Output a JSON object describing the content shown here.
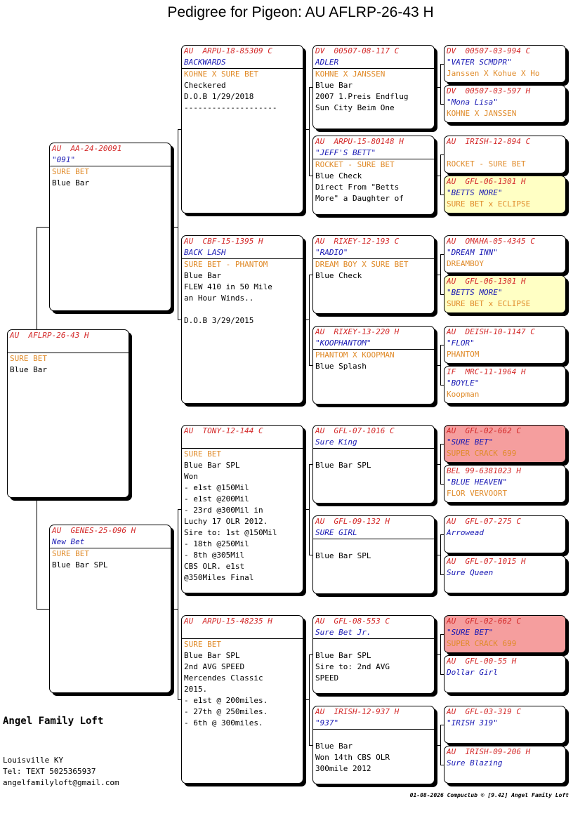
{
  "title": "Pedigree for Pigeon: AU  AFLRP-26-43 H",
  "cards": [
    {
      "id": "subject",
      "band": "AU  AFLRP-26-43 H",
      "name": "",
      "strain": "SURE BET",
      "notes": [
        "Blue Bar"
      ],
      "hl": ""
    },
    {
      "id": "sire",
      "band": "AU  AA-24-20091",
      "name": "\"091\"",
      "strain": "SURE BET",
      "notes": [
        "Blue Bar"
      ],
      "hl": ""
    },
    {
      "id": "dam",
      "band": "AU  GENES-25-096 H",
      "name": "New Bet",
      "strain": "SURE BET",
      "notes": [
        "Blue Bar SPL"
      ],
      "hl": ""
    },
    {
      "id": "ss",
      "band": "AU  ARPU-18-85309 C",
      "name": "BACKWARDS",
      "strain": "KOHNE X SURE BET",
      "notes": [
        "Checkered",
        "D.O.B 1/29/2018",
        "--------------------"
      ],
      "hl": ""
    },
    {
      "id": "sd",
      "band": "AU  CBF-15-1395 H",
      "name": "BACK LASH",
      "strain": "SURE BET - PHANTOM",
      "notes": [
        "Blue Bar",
        "FLEW 410 in 50 Mile",
        "an Hour Winds..",
        "",
        "D.O.B 3/29/2015"
      ],
      "hl": ""
    },
    {
      "id": "ds",
      "band": "AU  TONY-12-144 C",
      "name": "",
      "strain": "SURE BET",
      "notes": [
        "Blue Bar SPL",
        "Won",
        "- e1st @150Mil",
        "- e1st @200Mil",
        "- 23rd @300Mil in",
        "Luchy 17 OLR 2012.",
        "Sire to: 1st @150Mil",
        "- 18th @250Mil",
        "- 8th @305Mil",
        "CBS OLR. e1st",
        "@350Miles Final"
      ],
      "hl": ""
    },
    {
      "id": "dd",
      "band": "AU  ARPU-15-48235 H",
      "name": "",
      "strain": "SURE BET",
      "notes": [
        "Blue Bar SPL",
        "2nd AVG SPEED",
        "Mercendes Classic",
        "2015.",
        "- e1st @ 200miles.",
        "- 27th @ 250miles.",
        "- 6th @ 300miles."
      ],
      "hl": ""
    },
    {
      "id": "sss",
      "band": "DV  00507-08-117 C",
      "name": "ADLER",
      "strain": "KOHNE X JANSSEN",
      "notes": [
        "Blue Bar",
        "2007 1.Preis Endflug",
        "Sun City Beim One"
      ],
      "hl": ""
    },
    {
      "id": "ssd",
      "band": "AU  ARPU-15-80148 H",
      "name": "\"JEFF'S BETT\"",
      "strain": "ROCKET - SURE BET",
      "notes": [
        "Blue Check",
        "Direct From \"Betts",
        "More\" a Daughter of"
      ],
      "hl": ""
    },
    {
      "id": "sds",
      "band": "AU  RIXEY-12-193 C",
      "name": "\"RADIO\"",
      "strain": "DREAM BOY X SURE BET",
      "notes": [
        "Blue Check"
      ],
      "hl": ""
    },
    {
      "id": "sdd",
      "band": "AU  RIXEY-13-220 H",
      "name": "\"KOOPHANTOM\"",
      "strain": "PHANTOM X KOOPMAN",
      "notes": [
        "Blue Splash"
      ],
      "hl": ""
    },
    {
      "id": "dss",
      "band": "AU  GFL-07-1016 C",
      "name": "Sure King",
      "strain": "",
      "notes": [
        "Blue Bar SPL"
      ],
      "hl": ""
    },
    {
      "id": "dsd",
      "band": "AU  GFL-09-132 H",
      "name": "SURE GIRL",
      "strain": "",
      "notes": [
        "Blue Bar SPL"
      ],
      "hl": ""
    },
    {
      "id": "dds",
      "band": "AU  GFL-08-553 C",
      "name": "Sure Bet Jr.",
      "strain": "",
      "notes": [
        "Blue Bar SPL",
        "Sire to: 2nd AVG",
        "SPEED"
      ],
      "hl": ""
    },
    {
      "id": "ddd",
      "band": "AU  IRISH-12-937 H",
      "name": "\"937\"",
      "strain": "",
      "notes": [
        "Blue Bar",
        "Won 14th CBS OLR",
        "300mile 2012"
      ],
      "hl": ""
    },
    {
      "id": "g1",
      "band": "DV  00507-03-994 C",
      "name": "\"VATER SCMDPR\"",
      "strain": "Janssen X Kohue X Ho",
      "notes": [],
      "hl": ""
    },
    {
      "id": "g2",
      "band": "DV  00507-03-597 H",
      "name": "\"Mona Lisa\"",
      "strain": "KOHNE X JANSSEN",
      "notes": [],
      "hl": ""
    },
    {
      "id": "g3",
      "band": "AU  IRISH-12-894 C",
      "name": "",
      "strain": "ROCKET - SURE BET",
      "notes": [],
      "hl": ""
    },
    {
      "id": "g4",
      "band": "AU  GFL-06-1301 H",
      "name": "\"BETTS MORE\"",
      "strain": "SURE BET x ECLIPSE",
      "notes": [],
      "hl": "yellow"
    },
    {
      "id": "g5",
      "band": "AU  OMAHA-05-4345 C",
      "name": "\"DREAM INN\"",
      "strain": "DREAMBOY",
      "notes": [],
      "hl": ""
    },
    {
      "id": "g6",
      "band": "AU  GFL-06-1301 H",
      "name": "\"BETTS MORE\"",
      "strain": "SURE BET x ECLIPSE",
      "notes": [],
      "hl": "yellow"
    },
    {
      "id": "g7",
      "band": "AU  DEISH-10-1147 C",
      "name": "\"FLOR\"",
      "strain": "PHANTOM",
      "notes": [],
      "hl": ""
    },
    {
      "id": "g8",
      "band": "IF  MRC-11-1964 H",
      "name": "\"BOYLE\"",
      "strain": "Koopman",
      "notes": [],
      "hl": ""
    },
    {
      "id": "g9",
      "band": "AU  GFL-02-662 C",
      "name": "\"SURE BET\"",
      "strain": "SUPER CRACK 699",
      "notes": [],
      "hl": "pink"
    },
    {
      "id": "g10",
      "band": "BEL 99-6381023 H",
      "name": "\"BLUE HEAVEN\"",
      "strain": "FLOR VERVOORT",
      "notes": [],
      "hl": ""
    },
    {
      "id": "g11",
      "band": "AU  GFL-07-275 C",
      "name": "Arrowead",
      "strain": "",
      "notes": [],
      "hl": ""
    },
    {
      "id": "g12",
      "band": "AU  GFL-07-1015 H",
      "name": "Sure Queen",
      "strain": "",
      "notes": [],
      "hl": ""
    },
    {
      "id": "g13",
      "band": "AU  GFL-02-662 C",
      "name": "\"SURE BET\"",
      "strain": "SUPER CRACK 699",
      "notes": [],
      "hl": "pink"
    },
    {
      "id": "g14",
      "band": "AU  GFL-00-55 H",
      "name": "Dollar Girl",
      "strain": "",
      "notes": [],
      "hl": ""
    },
    {
      "id": "g15",
      "band": "AU  GFL-03-319 C",
      "name": "\"IRISH 319\"",
      "strain": "",
      "notes": [],
      "hl": ""
    },
    {
      "id": "g16",
      "band": "AU  IRISH-09-206 H",
      "name": "Sure Blazing",
      "strain": "",
      "notes": [],
      "hl": ""
    }
  ],
  "footer": {
    "loft": "Angel Family Loft",
    "city": "Louisville KY",
    "tel": "Tel: TEXT 5025365937",
    "email": "angelfamilyloft@gmail.com",
    "stamp": "01-08-2026  Compuclub © [9.42]  Angel Family Loft"
  },
  "colors": {
    "band": "#d42a2a",
    "name": "#1a1ab4",
    "strain": "#e08b2a",
    "yellow": "#ffffc4",
    "pink": "#f59e9e"
  }
}
